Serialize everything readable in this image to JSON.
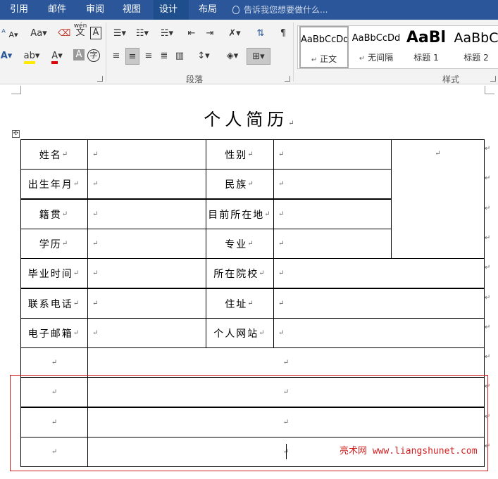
{
  "tabs": [
    {
      "label": "引用",
      "active": false
    },
    {
      "label": "邮件",
      "active": false
    },
    {
      "label": "审阅",
      "active": false
    },
    {
      "label": "视图",
      "active": false
    },
    {
      "label": "设计",
      "active": true
    },
    {
      "label": "布局",
      "active": false
    }
  ],
  "tellme": "告诉我您想要做什么...",
  "ribbon": {
    "font_aa_label": "Aa",
    "wen_label": "wén",
    "wen_char": "文",
    "box_a": "A",
    "paragraph_group": "段落",
    "styles_group": "样式",
    "styles": [
      {
        "sample": "AaBbCcDd",
        "name": "正文",
        "selected": true
      },
      {
        "sample": "AaBbCcDd",
        "name": "无间隔",
        "selected": false
      },
      {
        "sample": "AaBl",
        "name": "标题 1",
        "selected": false
      },
      {
        "sample": "AaBbC",
        "name": "标题 2",
        "selected": false
      }
    ]
  },
  "doc": {
    "title": "个人简历",
    "rows": [
      {
        "l1": "姓名",
        "l2": "性别"
      },
      {
        "l1": "出生年月",
        "l2": "民族"
      },
      {
        "l1": "籍贯",
        "l2": "目前所在地"
      },
      {
        "l1": "学历",
        "l2": "专业"
      },
      {
        "l1": "毕业时间",
        "l2": "所在院校"
      },
      {
        "l1": "联系电话",
        "l2": "住址"
      },
      {
        "l1": "电子邮箱",
        "l2": "个人网站"
      }
    ],
    "para_mark": "↵"
  },
  "watermark": "亮术网 www.liangshunet.com"
}
